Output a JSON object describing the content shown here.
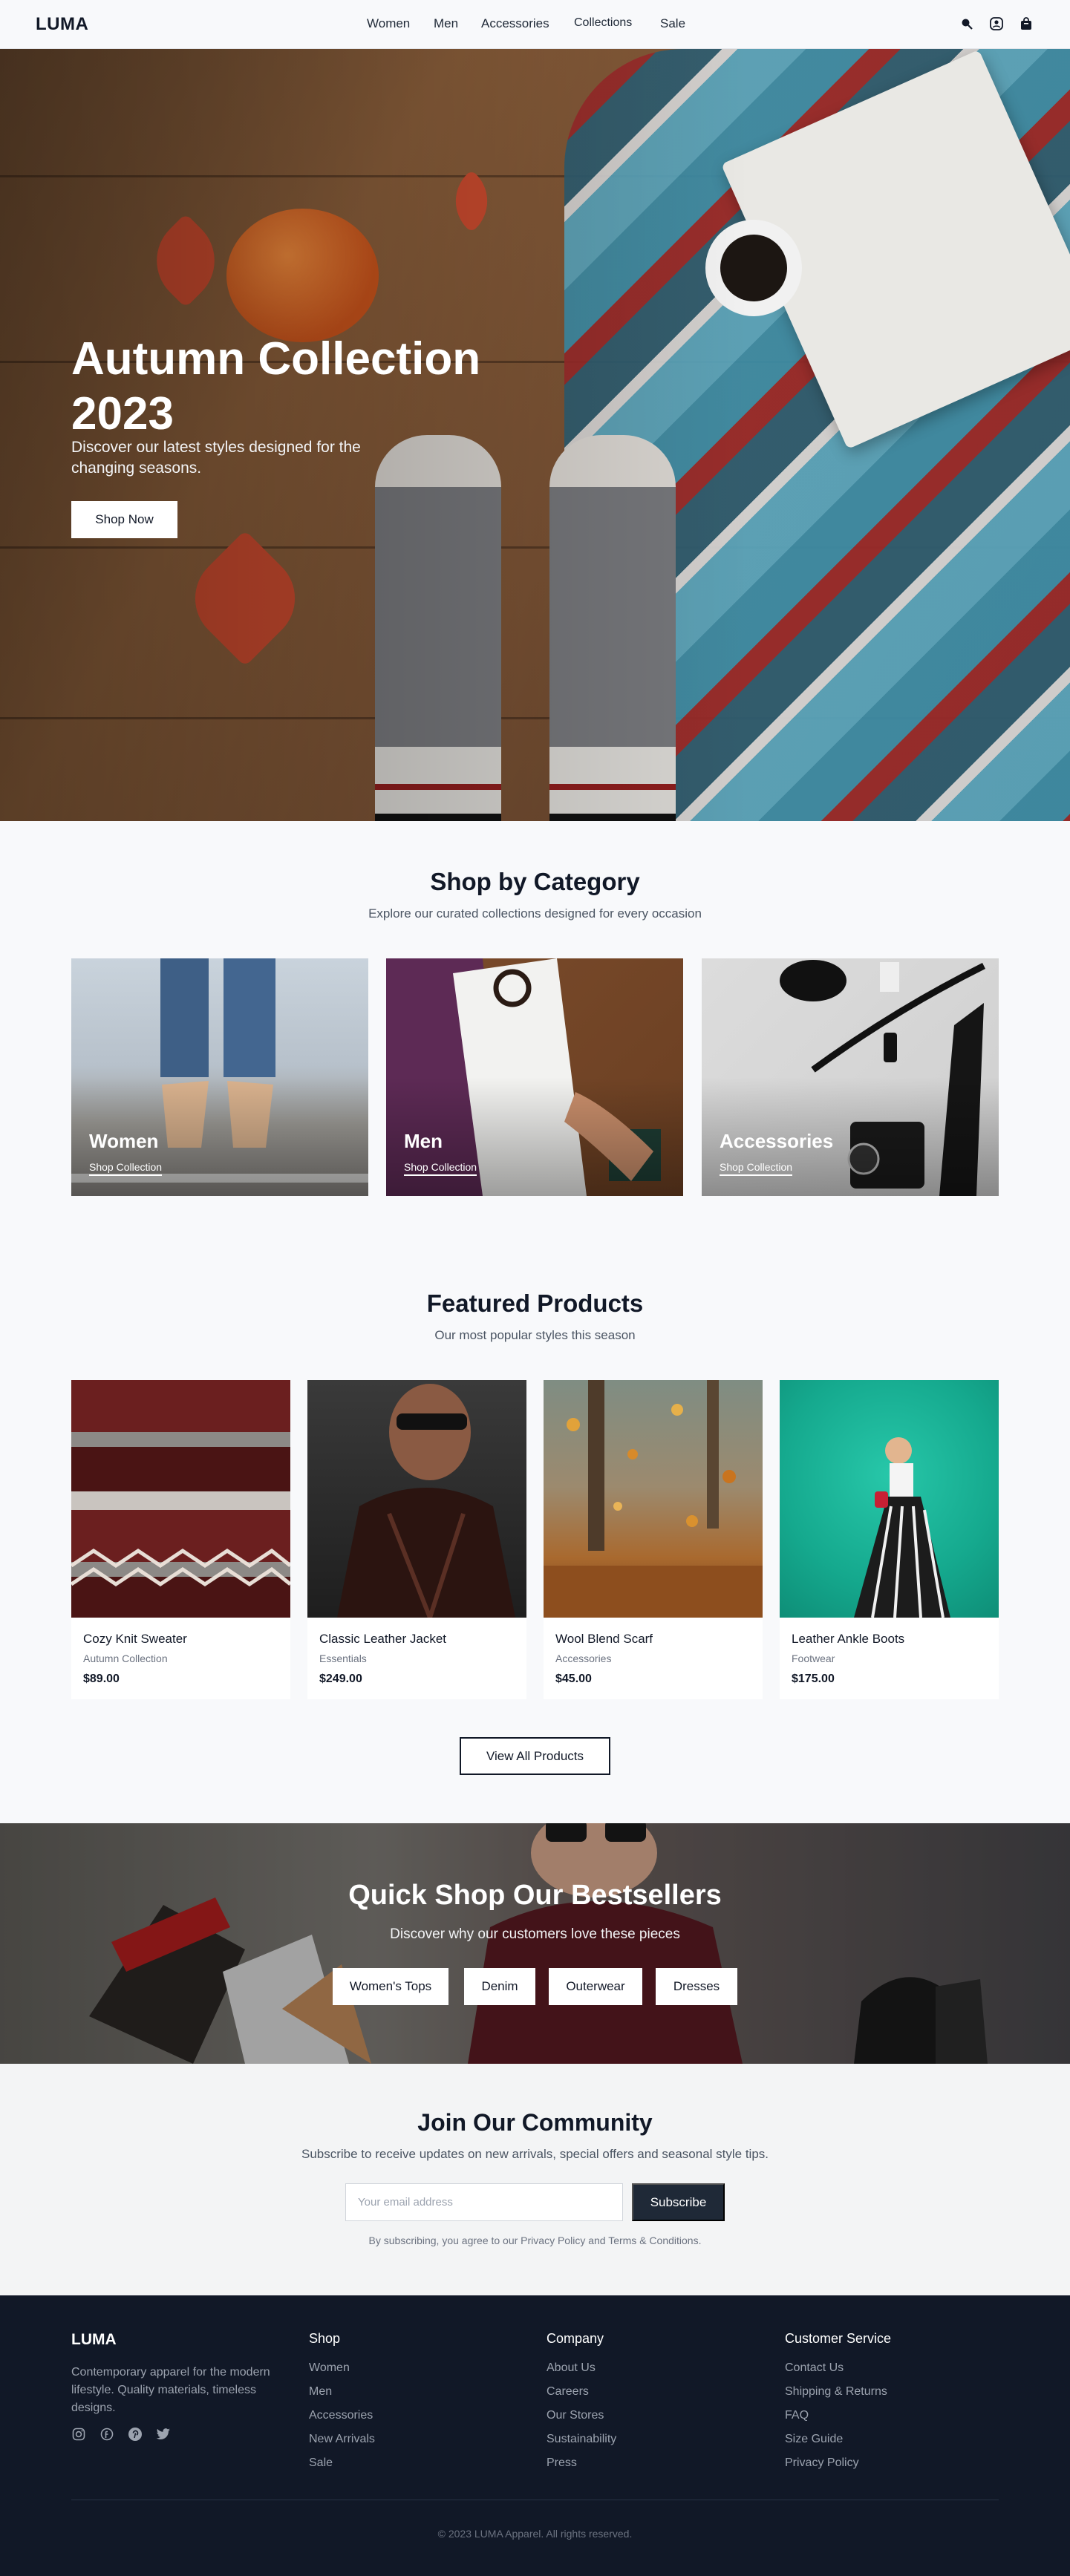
{
  "header": {
    "logo": "LUMA",
    "nav": [
      "Women",
      "Men",
      "Accessories",
      "Collections",
      "Sale"
    ],
    "icons": [
      "search-icon",
      "account-icon",
      "bag-icon"
    ]
  },
  "hero": {
    "title": "Autumn Collection 2023",
    "subtitle": "Discover our latest styles designed for the changing seasons.",
    "cta": "Shop Now"
  },
  "categories": {
    "title": "Shop by Category",
    "subtitle": "Explore our curated collections designed for every occasion",
    "items": [
      {
        "label": "Women",
        "link": "Shop Collection"
      },
      {
        "label": "Men",
        "link": "Shop Collection"
      },
      {
        "label": "Accessories",
        "link": "Shop Collection"
      }
    ]
  },
  "featured": {
    "title": "Featured Products",
    "subtitle": "Our most popular styles this season",
    "products": [
      {
        "name": "Cozy Knit Sweater",
        "category": "Autumn Collection",
        "price": "$89.00"
      },
      {
        "name": "Classic Leather Jacket",
        "category": "Essentials",
        "price": "$249.00"
      },
      {
        "name": "Wool Blend Scarf",
        "category": "Accessories",
        "price": "$45.00"
      },
      {
        "name": "Leather Ankle Boots",
        "category": "Footwear",
        "price": "$175.00"
      }
    ],
    "view_all": "View All Products"
  },
  "bestsellers": {
    "title": "Quick Shop Our Bestsellers",
    "subtitle": "Discover why our customers love these pieces",
    "buttons": [
      "Women's Tops",
      "Denim",
      "Outerwear",
      "Dresses"
    ]
  },
  "newsletter": {
    "title": "Join Our Community",
    "subtitle": "Subscribe to receive updates on new arrivals, special offers and seasonal style tips.",
    "placeholder": "Your email address",
    "button": "Subscribe",
    "note": "By subscribing, you agree to our Privacy Policy and Terms & Conditions."
  },
  "footer": {
    "logo": "LUMA",
    "description": "Contemporary apparel for the modern lifestyle. Quality materials, timeless designs.",
    "social": [
      "instagram-icon",
      "facebook-icon",
      "pinterest-icon",
      "twitter-icon"
    ],
    "columns": [
      {
        "title": "Shop",
        "links": [
          "Women",
          "Men",
          "Accessories",
          "New Arrivals",
          "Sale"
        ]
      },
      {
        "title": "Company",
        "links": [
          "About Us",
          "Careers",
          "Our Stores",
          "Sustainability",
          "Press"
        ]
      },
      {
        "title": "Customer Service",
        "links": [
          "Contact Us",
          "Shipping & Returns",
          "FAQ",
          "Size Guide",
          "Privacy Policy"
        ]
      }
    ],
    "copyright": "© 2023 LUMA Apparel. All rights reserved."
  },
  "colors": {
    "dark": "#111827",
    "button_dark": "#1f2937",
    "muted": "#6b7280",
    "page_bg": "#f8f9fb"
  }
}
